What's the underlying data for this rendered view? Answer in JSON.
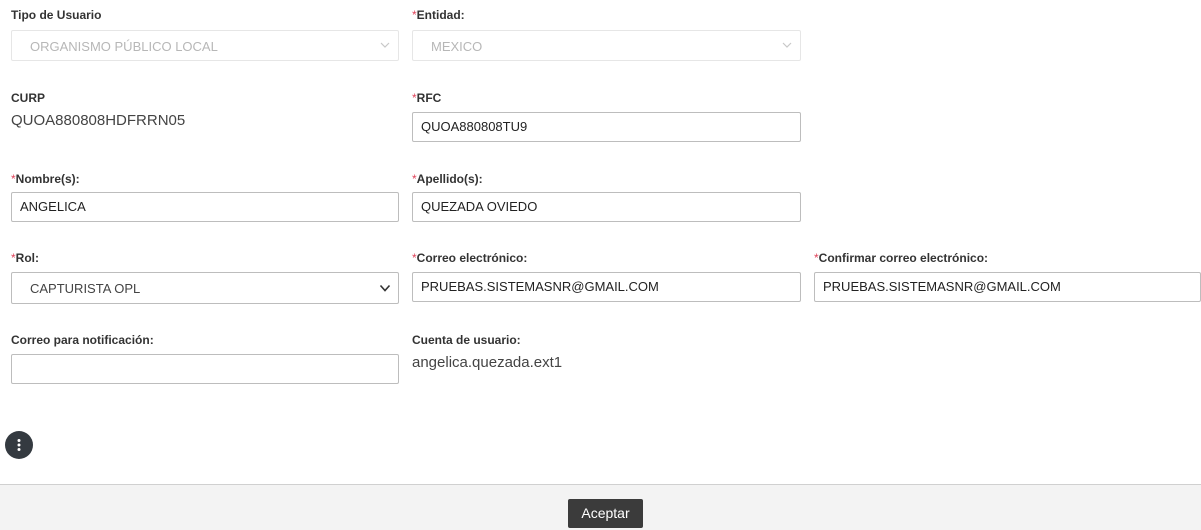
{
  "form": {
    "tipo_usuario": {
      "label": "Tipo de Usuario",
      "value": "ORGANISMO PÚBLICO LOCAL"
    },
    "entidad": {
      "required": "*",
      "label": "Entidad:",
      "value": "MEXICO"
    },
    "curp": {
      "label": "CURP",
      "value": "QUOA880808HDFRRN05"
    },
    "rfc": {
      "required": "*",
      "label": "RFC",
      "value": "QUOA880808TU9"
    },
    "nombre": {
      "required": "*",
      "label": "Nombre(s):",
      "value": "ANGELICA"
    },
    "apellido": {
      "required": "*",
      "label": "Apellido(s):",
      "value": "QUEZADA OVIEDO"
    },
    "rol": {
      "required": "*",
      "label": "Rol:",
      "value": "CAPTURISTA OPL"
    },
    "correo": {
      "required": "*",
      "label": "Correo electrónico:",
      "value": "PRUEBAS.SISTEMASNR@GMAIL.COM"
    },
    "confirmar_correo": {
      "required": "*",
      "label": "Confirmar correo electrónico:",
      "value": "PRUEBAS.SISTEMASNR@GMAIL.COM"
    },
    "correo_notificacion": {
      "label": "Correo para notificación:",
      "value": ""
    },
    "cuenta_usuario": {
      "label": "Cuenta de usuario:",
      "value": "angelica.quezada.ext1"
    }
  },
  "footer": {
    "accept_label": "Aceptar"
  },
  "icons": {
    "fab": "more-vertical-icon",
    "select": "chevron-down-icon"
  }
}
